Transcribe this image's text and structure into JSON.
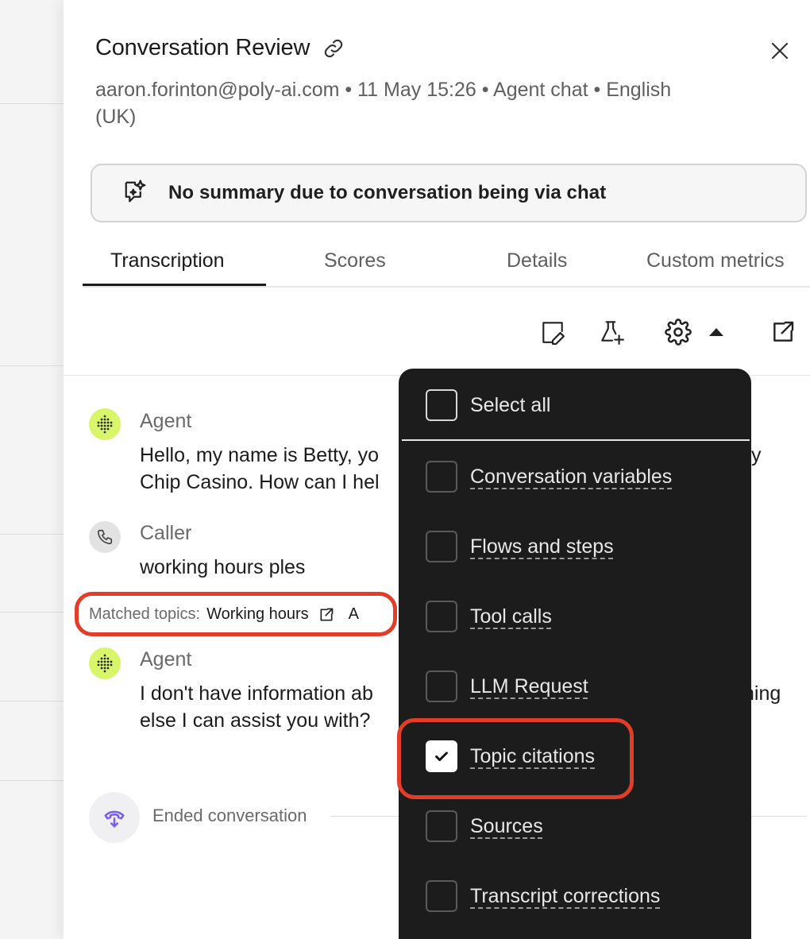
{
  "header": {
    "title": "Conversation Review",
    "meta_line1": "aaron.forinton@poly-ai.com • 11 May 15:26 • Agent chat • English",
    "meta_line2": "(UK)"
  },
  "summary": {
    "text": "No summary due to conversation being via chat"
  },
  "tabs": [
    {
      "label": "Transcription",
      "active": true
    },
    {
      "label": "Scores"
    },
    {
      "label": "Details"
    },
    {
      "label": "Custom metrics"
    }
  ],
  "toolbar": {
    "icons": [
      "edit-note-icon",
      "flask-add-icon",
      "gear-icon",
      "caret-up-icon",
      "external-link-icon"
    ]
  },
  "transcript": {
    "messages": [
      {
        "speaker": "Agent",
        "line1": "Hello, my name is Betty, yo",
        "line1_right": "y",
        "line2": "Chip Casino. How can I hel"
      },
      {
        "speaker": "Caller",
        "line1": "working hours ples"
      },
      {
        "speaker": "Agent",
        "line1": "I don't have information ab",
        "line1_right": "hing",
        "line2": "else I can assist you with?"
      }
    ],
    "matched_topics": {
      "label": "Matched topics:",
      "value": "Working hours",
      "extra": "A"
    },
    "ended": "Ended conversation"
  },
  "dropdown": {
    "select_all": "Select all",
    "options": [
      {
        "label": "Conversation variables",
        "checked": false
      },
      {
        "label": "Flows and steps",
        "checked": false
      },
      {
        "label": "Tool calls",
        "checked": false
      },
      {
        "label": "LLM Request",
        "checked": false
      },
      {
        "label": "Topic citations",
        "checked": true
      },
      {
        "label": "Sources",
        "checked": false
      },
      {
        "label": "Transcript corrections",
        "checked": false
      }
    ]
  },
  "colors": {
    "highlight": "#e23d28",
    "agent_avatar": "#d9f56a",
    "dropdown_bg": "#1c1c1c",
    "ended_icon": "#7a5cf0"
  }
}
